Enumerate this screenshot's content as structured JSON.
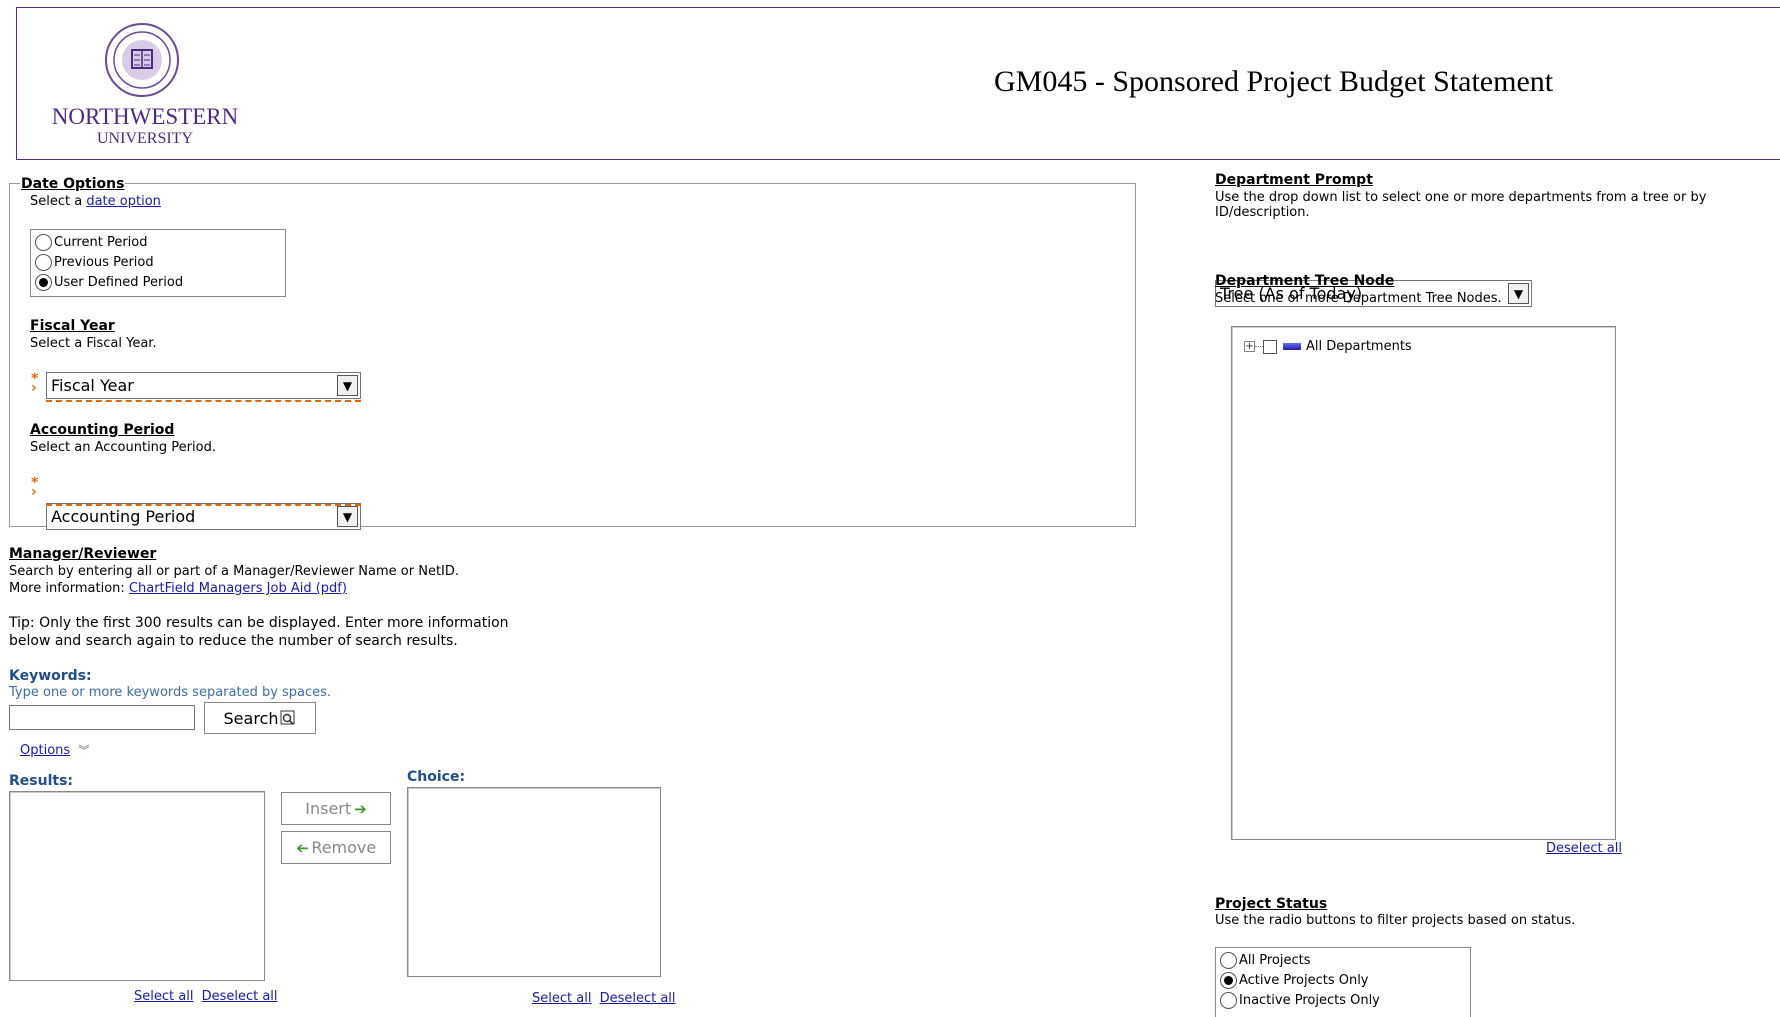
{
  "header": {
    "university_name": "NORTHWESTERN",
    "university_sub": "UNIVERSITY",
    "report_title": "GM045 - Sponsored Project Budget Statement"
  },
  "date_options": {
    "title": "Date Options",
    "instruction_prefix": "Select a",
    "instruction_link": "date option",
    "options": [
      {
        "label": "Current Period",
        "selected": false
      },
      {
        "label": "Previous Period",
        "selected": false
      },
      {
        "label": "User Defined Period",
        "selected": true
      }
    ]
  },
  "fiscal_year": {
    "title": "Fiscal Year",
    "instruction": "Select a Fiscal Year.",
    "value": "Fiscal Year"
  },
  "accounting_period": {
    "title": "Accounting Period",
    "instruction": "Select an Accounting Period.",
    "value": "Accounting Period"
  },
  "manager": {
    "title": "Manager/Reviewer",
    "line1": "Search by entering all or part of a Manager/Reviewer Name or NetID.",
    "more_prefix": "More information:",
    "more_link": "ChartField Managers Job Aid (pdf)",
    "tip_line1": "Tip: Only the first 300 results can be displayed. Enter more information",
    "tip_line2": "below and search again to reduce the number of search results.",
    "keywords_label": "Keywords:",
    "keywords_hint": "Type one or more keywords separated by spaces.",
    "keywords_value": "",
    "search_label": "Search",
    "options_link": "Options",
    "results_label": "Results:",
    "choice_label": "Choice:",
    "insert_label": "Insert",
    "remove_label": "Remove",
    "select_all": "Select all",
    "deselect_all": "Deselect all"
  },
  "department_prompt": {
    "title": "Department Prompt",
    "instruction": "Use the drop down list to select one or more departments from a tree or by ID/description.",
    "value": "Tree (As of Today)"
  },
  "department_tree": {
    "title": "Department Tree Node",
    "instruction": "Select one or more Department Tree Nodes.",
    "root_label": "All Departments",
    "deselect_all": "Deselect all"
  },
  "project_status": {
    "title": "Project Status",
    "instruction": "Use the radio buttons to filter projects based on status.",
    "options": [
      {
        "label": "All Projects",
        "selected": false
      },
      {
        "label": "Active Projects Only",
        "selected": true
      },
      {
        "label": "Inactive Projects Only",
        "selected": false
      }
    ]
  },
  "colors": {
    "brand_purple": "#4e2a84",
    "required_orange": "#e06a00",
    "link_blue": "#1a1aa6"
  }
}
